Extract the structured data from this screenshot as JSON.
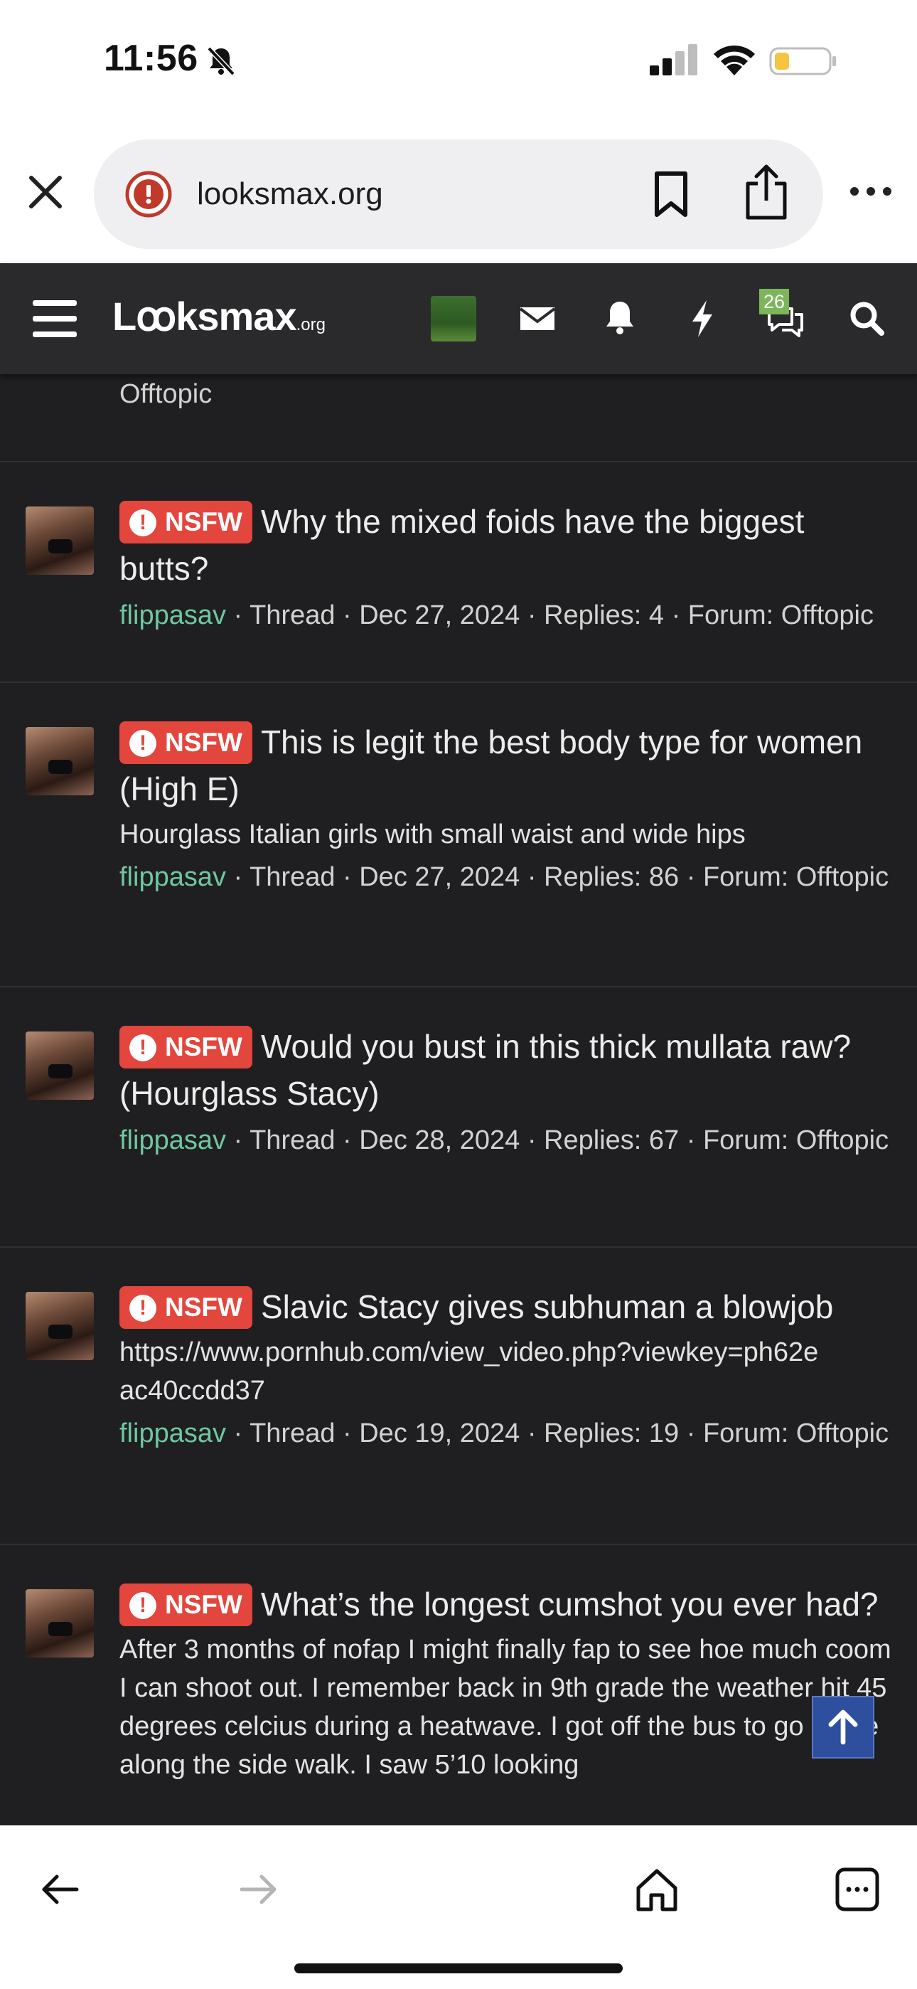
{
  "status_bar": {
    "time": "11:56"
  },
  "browser": {
    "url": "looksmax.org"
  },
  "site_header": {
    "logo_text": "Lꝏksmax",
    "logo_suffix": ".org",
    "chat_badge": "26",
    "icons": [
      "menu-icon",
      "mail-icon",
      "bell-icon",
      "bolt-icon",
      "chat-icon",
      "search-icon"
    ]
  },
  "partial_row": {
    "meta_tail": "Offtopic"
  },
  "results": [
    {
      "badge": "NSFW",
      "title": "Why the mixed foids have the biggest butts?",
      "snippet": "",
      "user": "flippasav",
      "meta": " · Thread · Dec 27, 2024 · Replies: 4 · Forum: Offtopic"
    },
    {
      "badge": "NSFW",
      "title": "This is legit the best body type for women (High E)",
      "snippet": "Hourglass Italian girls with small waist and wide hips",
      "user": "flippasav",
      "meta": " · Thread · Dec 27, 2024 · Replies: 86 · Forum: Offtopic"
    },
    {
      "badge": "NSFW",
      "title": "Would you bust in this thick mullata raw? (Hourglass Stacy)",
      "snippet": "",
      "user": "flippasav",
      "meta": " · Thread · Dec 28, 2024 · Replies: 67 · Forum: Offtopic"
    },
    {
      "badge": "NSFW",
      "title": "Slavic Stacy gives subhuman a blowjob",
      "snippet": "https://www.pornhub.com/view_video.php?viewkey=ph62eac40ccdd37",
      "user": "flippasav",
      "meta": " · Thread · Dec 19, 2024 · Replies: 19 · Forum: Offtopic"
    },
    {
      "badge": "NSFW",
      "title": "What’s the longest cumshot you ever had?",
      "snippet": "After 3 months of nofap I might finally fap to see hoe much coom I can shoot out. I remember back in 9th grade the weather hit 45 degrees celcius during a heatwave. I got off the bus to go home along the side walk. I saw 5’10 looking",
      "user": "",
      "meta": ""
    }
  ],
  "colors": {
    "background": "#1f1f21",
    "header": "#2a2a2c",
    "nsfw_badge": "#e2463d",
    "username": "#6fc7a0",
    "scroll_top_button": "#2e4e9e"
  }
}
